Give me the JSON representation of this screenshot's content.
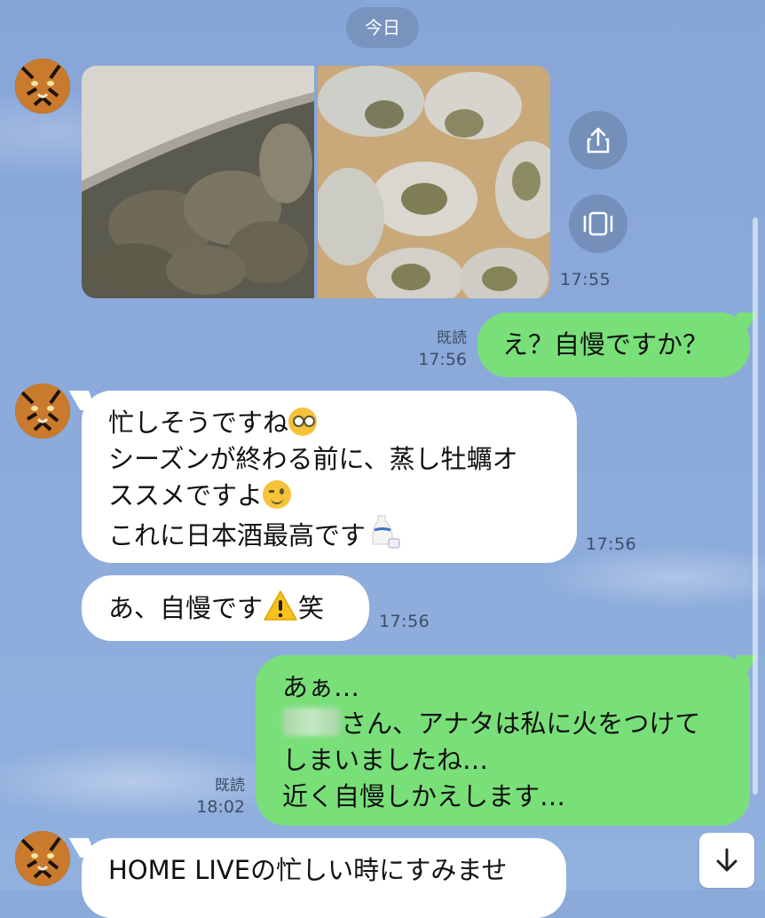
{
  "date_divider": "今日",
  "messages": {
    "m1": {
      "time": "17:55"
    },
    "m2": {
      "read": "既読",
      "time": "17:56",
      "text": "え？自慢ですか？"
    },
    "m3": {
      "time": "17:56",
      "lines": [
        "忙しそうですね",
        "シーズンが終わる前に、蒸し牡蠣オ",
        "ススメですよ",
        "これに日本酒最高です"
      ]
    },
    "m4": {
      "time": "17:56",
      "text_a": "あ、自慢です",
      "text_b": "笑"
    },
    "m5": {
      "read": "既読",
      "time": "18:02",
      "line1": "あぁ…",
      "line2_suffix": "さん、アナタは私に火をつけて",
      "line3": "しまいましたね…",
      "line4": "近く自慢しかえします…"
    },
    "m6": {
      "text_a": "HOME LIVE",
      "text_b": "の忙しい時にすみませ"
    }
  },
  "icons": {
    "share": "share-icon",
    "carousel": "carousel-icon",
    "scroll_down": "arrow-down-icon"
  }
}
